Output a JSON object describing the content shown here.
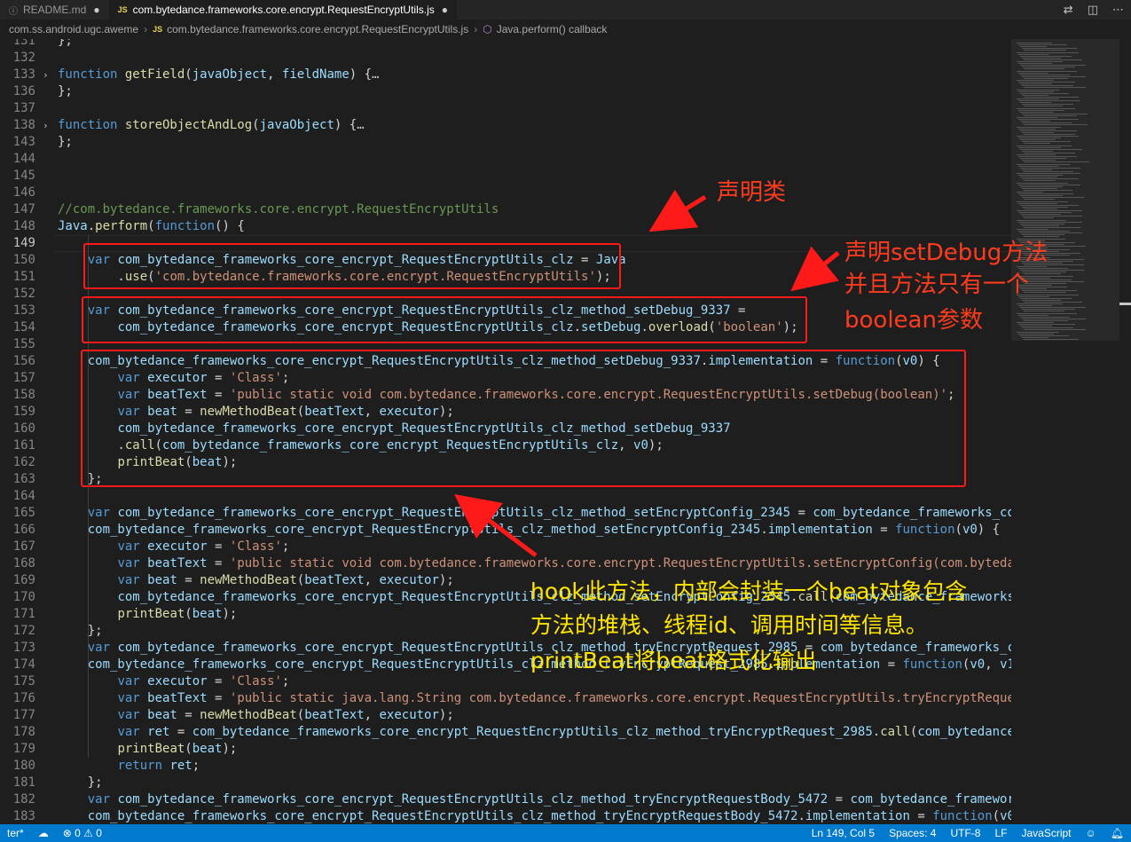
{
  "tabs": [
    {
      "icon": "ⓘ",
      "label": "README.md",
      "dirty": "●"
    },
    {
      "icon": "JS",
      "label": "com.bytedance.frameworks.core.encrypt.RequestEncryptUtils.js",
      "dirty": "●"
    }
  ],
  "breadcrumb": {
    "folder": "com.ss.android.ugc.aweme",
    "file_icon": "JS",
    "file": "com.bytedance.frameworks.core.encrypt.RequestEncryptUtils.js",
    "symbol": "Java.perform() callback"
  },
  "annotations": {
    "declare_class": "声明类",
    "declare_method": [
      "声明setDebug方法",
      "并且方法只有一个",
      "boolean参数"
    ],
    "hook_desc": [
      "hook此方法，内部会封装一个beat对象包含",
      "方法的堆栈、线程id、调用时间等信息。",
      "printBeat将beat格式化输出"
    ]
  },
  "status": {
    "left_mode": "ter*",
    "errors": "0",
    "warnings": "0",
    "position": "Ln 149, Col 5",
    "spaces": "Spaces: 4",
    "encoding": "UTF-8",
    "eol": "LF",
    "language": "JavaScript"
  },
  "code_lines": [
    {
      "n": "131",
      "t": [
        [
          "pl",
          "};"
        ]
      ]
    },
    {
      "n": "132",
      "t": []
    },
    {
      "n": "133",
      "fold": "›",
      "t": [
        [
          "kw",
          "function "
        ],
        [
          "fn",
          "getField"
        ],
        [
          "pl",
          "("
        ],
        [
          "var",
          "javaObject"
        ],
        [
          "pl",
          ", "
        ],
        [
          "var",
          "fieldName"
        ],
        [
          "pl",
          ") {"
        ],
        [
          "ell",
          "…"
        ]
      ]
    },
    {
      "n": "136",
      "t": [
        [
          "pl",
          "};"
        ]
      ]
    },
    {
      "n": "137",
      "t": []
    },
    {
      "n": "138",
      "fold": "›",
      "t": [
        [
          "kw",
          "function "
        ],
        [
          "fn",
          "storeObjectAndLog"
        ],
        [
          "pl",
          "("
        ],
        [
          "var",
          "javaObject"
        ],
        [
          "pl",
          ") {"
        ],
        [
          "ell",
          "…"
        ]
      ]
    },
    {
      "n": "143",
      "t": [
        [
          "pl",
          "};"
        ]
      ]
    },
    {
      "n": "144",
      "t": []
    },
    {
      "n": "145",
      "t": []
    },
    {
      "n": "146",
      "t": []
    },
    {
      "n": "147",
      "t": [
        [
          "cm",
          "//com.bytedance.frameworks.core.encrypt.RequestEncryptUtils"
        ]
      ]
    },
    {
      "n": "148",
      "t": [
        [
          "var",
          "Java"
        ],
        [
          "pl",
          "."
        ],
        [
          "fn",
          "perform"
        ],
        [
          "pl",
          "("
        ],
        [
          "kw",
          "function"
        ],
        [
          "pl",
          "() {"
        ]
      ]
    },
    {
      "n": "149",
      "t": [],
      "current": true
    },
    {
      "n": "150",
      "t": [
        [
          "pl",
          "    "
        ],
        [
          "kw",
          "var "
        ],
        [
          "var",
          "com_bytedance_frameworks_core_encrypt_RequestEncryptUtils_clz"
        ],
        [
          "pl",
          " = "
        ],
        [
          "var",
          "Java"
        ]
      ]
    },
    {
      "n": "151",
      "t": [
        [
          "pl",
          "        ."
        ],
        [
          "fn",
          "use"
        ],
        [
          "pl",
          "("
        ],
        [
          "str",
          "'com.bytedance.frameworks.core.encrypt.RequestEncryptUtils'"
        ],
        [
          "pl",
          ");"
        ]
      ]
    },
    {
      "n": "152",
      "t": []
    },
    {
      "n": "153",
      "t": [
        [
          "pl",
          "    "
        ],
        [
          "kw",
          "var "
        ],
        [
          "var",
          "com_bytedance_frameworks_core_encrypt_RequestEncryptUtils_clz_method_setDebug_9337"
        ],
        [
          "pl",
          " ="
        ]
      ]
    },
    {
      "n": "154",
      "t": [
        [
          "pl",
          "        "
        ],
        [
          "var",
          "com_bytedance_frameworks_core_encrypt_RequestEncryptUtils_clz"
        ],
        [
          "pl",
          "."
        ],
        [
          "var",
          "setDebug"
        ],
        [
          "pl",
          "."
        ],
        [
          "fn",
          "overload"
        ],
        [
          "pl",
          "("
        ],
        [
          "str",
          "'boolean'"
        ],
        [
          "pl",
          ");"
        ]
      ]
    },
    {
      "n": "155",
      "t": []
    },
    {
      "n": "156",
      "t": [
        [
          "pl",
          "    "
        ],
        [
          "var",
          "com_bytedance_frameworks_core_encrypt_RequestEncryptUtils_clz_method_setDebug_9337"
        ],
        [
          "pl",
          "."
        ],
        [
          "var",
          "implementation"
        ],
        [
          "pl",
          " = "
        ],
        [
          "kw",
          "function"
        ],
        [
          "pl",
          "("
        ],
        [
          "var",
          "v0"
        ],
        [
          "pl",
          ") {"
        ]
      ]
    },
    {
      "n": "157",
      "t": [
        [
          "pl",
          "        "
        ],
        [
          "kw",
          "var "
        ],
        [
          "var",
          "executor"
        ],
        [
          "pl",
          " = "
        ],
        [
          "str",
          "'Class'"
        ],
        [
          "pl",
          ";"
        ]
      ]
    },
    {
      "n": "158",
      "t": [
        [
          "pl",
          "        "
        ],
        [
          "kw",
          "var "
        ],
        [
          "var",
          "beatText"
        ],
        [
          "pl",
          " = "
        ],
        [
          "str",
          "'public static void com.bytedance.frameworks.core.encrypt.RequestEncryptUtils.setDebug(boolean)'"
        ],
        [
          "pl",
          ";"
        ]
      ]
    },
    {
      "n": "159",
      "t": [
        [
          "pl",
          "        "
        ],
        [
          "kw",
          "var "
        ],
        [
          "var",
          "beat"
        ],
        [
          "pl",
          " = "
        ],
        [
          "fn",
          "newMethodBeat"
        ],
        [
          "pl",
          "("
        ],
        [
          "var",
          "beatText"
        ],
        [
          "pl",
          ", "
        ],
        [
          "var",
          "executor"
        ],
        [
          "pl",
          ");"
        ]
      ]
    },
    {
      "n": "160",
      "t": [
        [
          "pl",
          "        "
        ],
        [
          "var",
          "com_bytedance_frameworks_core_encrypt_RequestEncryptUtils_clz_method_setDebug_9337"
        ]
      ]
    },
    {
      "n": "161",
      "t": [
        [
          "pl",
          "        ."
        ],
        [
          "fn",
          "call"
        ],
        [
          "pl",
          "("
        ],
        [
          "var",
          "com_bytedance_frameworks_core_encrypt_RequestEncryptUtils_clz"
        ],
        [
          "pl",
          ", "
        ],
        [
          "var",
          "v0"
        ],
        [
          "pl",
          ");"
        ]
      ]
    },
    {
      "n": "162",
      "t": [
        [
          "pl",
          "        "
        ],
        [
          "fn",
          "printBeat"
        ],
        [
          "pl",
          "("
        ],
        [
          "var",
          "beat"
        ],
        [
          "pl",
          ");"
        ]
      ]
    },
    {
      "n": "163",
      "t": [
        [
          "pl",
          "    };"
        ]
      ]
    },
    {
      "n": "164",
      "t": []
    },
    {
      "n": "165",
      "t": [
        [
          "pl",
          "    "
        ],
        [
          "kw",
          "var "
        ],
        [
          "var",
          "com_bytedance_frameworks_core_encrypt_RequestEncryptUtils_clz_method_setEncryptConfig_2345"
        ],
        [
          "pl",
          " = "
        ],
        [
          "var",
          "com_bytedance_frameworks_core_encrypt_RequestEncryptUtils_clz"
        ]
      ]
    },
    {
      "n": "166",
      "t": [
        [
          "pl",
          "    "
        ],
        [
          "var",
          "com_bytedance_frameworks_core_encrypt_RequestEncryptUtils_clz_method_setEncryptConfig_2345"
        ],
        [
          "pl",
          "."
        ],
        [
          "var",
          "implementation"
        ],
        [
          "pl",
          " = "
        ],
        [
          "kw",
          "function"
        ],
        [
          "pl",
          "("
        ],
        [
          "var",
          "v0"
        ],
        [
          "pl",
          ") {"
        ]
      ]
    },
    {
      "n": "167",
      "t": [
        [
          "pl",
          "        "
        ],
        [
          "kw",
          "var "
        ],
        [
          "var",
          "executor"
        ],
        [
          "pl",
          " = "
        ],
        [
          "str",
          "'Class'"
        ],
        [
          "pl",
          ";"
        ]
      ]
    },
    {
      "n": "168",
      "t": [
        [
          "pl",
          "        "
        ],
        [
          "kw",
          "var "
        ],
        [
          "var",
          "beatText"
        ],
        [
          "pl",
          " = "
        ],
        [
          "str",
          "'public static void com.bytedance.frameworks.core.encrypt.RequestEncryptUtils.setEncryptConfig(com.bytedance.frameworks"
        ]
      ]
    },
    {
      "n": "169",
      "t": [
        [
          "pl",
          "        "
        ],
        [
          "kw",
          "var "
        ],
        [
          "var",
          "beat"
        ],
        [
          "pl",
          " = "
        ],
        [
          "fn",
          "newMethodBeat"
        ],
        [
          "pl",
          "("
        ],
        [
          "var",
          "beatText"
        ],
        [
          "pl",
          ", "
        ],
        [
          "var",
          "executor"
        ],
        [
          "pl",
          ");"
        ]
      ]
    },
    {
      "n": "170",
      "t": [
        [
          "pl",
          "        "
        ],
        [
          "var",
          "com_bytedance_frameworks_core_encrypt_RequestEncryptUtils_clz_method_setEncryptConfig_2345"
        ],
        [
          "pl",
          "."
        ],
        [
          "fn",
          "call"
        ],
        [
          "pl",
          "("
        ],
        [
          "var",
          "com_bytedance_frameworks"
        ]
      ]
    },
    {
      "n": "171",
      "t": [
        [
          "pl",
          "        "
        ],
        [
          "fn",
          "printBeat"
        ],
        [
          "pl",
          "("
        ],
        [
          "var",
          "beat"
        ],
        [
          "pl",
          ");"
        ]
      ]
    },
    {
      "n": "172",
      "t": [
        [
          "pl",
          "    };"
        ]
      ]
    },
    {
      "n": "173",
      "t": [
        [
          "pl",
          "    "
        ],
        [
          "kw",
          "var "
        ],
        [
          "var",
          "com_bytedance_frameworks_core_encrypt_RequestEncryptUtils_clz_method_tryEncryptRequest_2985"
        ],
        [
          "pl",
          " = "
        ],
        [
          "var",
          "com_bytedance_frameworks_core"
        ]
      ]
    },
    {
      "n": "174",
      "t": [
        [
          "pl",
          "    "
        ],
        [
          "var",
          "com_bytedance_frameworks_core_encrypt_RequestEncryptUtils_clz_method_tryEncryptRequest_2985"
        ],
        [
          "pl",
          "."
        ],
        [
          "var",
          "implementation"
        ],
        [
          "pl",
          " = "
        ],
        [
          "kw",
          "function"
        ],
        [
          "pl",
          "("
        ],
        [
          "var",
          "v0"
        ],
        [
          "pl",
          ", "
        ],
        [
          "var",
          "v1"
        ],
        [
          "pl",
          ") {"
        ]
      ]
    },
    {
      "n": "175",
      "t": [
        [
          "pl",
          "        "
        ],
        [
          "kw",
          "var "
        ],
        [
          "var",
          "executor"
        ],
        [
          "pl",
          " = "
        ],
        [
          "str",
          "'Class'"
        ],
        [
          "pl",
          ";"
        ]
      ]
    },
    {
      "n": "176",
      "t": [
        [
          "pl",
          "        "
        ],
        [
          "kw",
          "var "
        ],
        [
          "var",
          "beatText"
        ],
        [
          "pl",
          " = "
        ],
        [
          "str",
          "'public static java.lang.String com.bytedance.frameworks.core.encrypt.RequestEncryptUtils.tryEncryptRequest(java.lang"
        ]
      ]
    },
    {
      "n": "177",
      "t": [
        [
          "pl",
          "        "
        ],
        [
          "kw",
          "var "
        ],
        [
          "var",
          "beat"
        ],
        [
          "pl",
          " = "
        ],
        [
          "fn",
          "newMethodBeat"
        ],
        [
          "pl",
          "("
        ],
        [
          "var",
          "beatText"
        ],
        [
          "pl",
          ", "
        ],
        [
          "var",
          "executor"
        ],
        [
          "pl",
          ");"
        ]
      ]
    },
    {
      "n": "178",
      "t": [
        [
          "pl",
          "        "
        ],
        [
          "kw",
          "var "
        ],
        [
          "var",
          "ret"
        ],
        [
          "pl",
          " = "
        ],
        [
          "var",
          "com_bytedance_frameworks_core_encrypt_RequestEncryptUtils_clz_method_tryEncryptRequest_2985"
        ],
        [
          "pl",
          "."
        ],
        [
          "fn",
          "call"
        ],
        [
          "pl",
          "("
        ],
        [
          "var",
          "com_bytedance_frameworks"
        ]
      ]
    },
    {
      "n": "179",
      "t": [
        [
          "pl",
          "        "
        ],
        [
          "fn",
          "printBeat"
        ],
        [
          "pl",
          "("
        ],
        [
          "var",
          "beat"
        ],
        [
          "pl",
          ");"
        ]
      ]
    },
    {
      "n": "180",
      "t": [
        [
          "pl",
          "        "
        ],
        [
          "kw",
          "return "
        ],
        [
          "var",
          "ret"
        ],
        [
          "pl",
          ";"
        ]
      ]
    },
    {
      "n": "181",
      "t": [
        [
          "pl",
          "    };"
        ]
      ]
    },
    {
      "n": "182",
      "t": [
        [
          "pl",
          "    "
        ],
        [
          "kw",
          "var "
        ],
        [
          "var",
          "com_bytedance_frameworks_core_encrypt_RequestEncryptUtils_clz_method_tryEncryptRequestBody_5472"
        ],
        [
          "pl",
          " = "
        ],
        [
          "var",
          "com_bytedance_frameworks_core"
        ]
      ]
    },
    {
      "n": "183",
      "t": [
        [
          "pl",
          "    "
        ],
        [
          "var",
          "com_bytedance_frameworks_core_encrypt_RequestEncryptUtils_clz_method_tryEncryptRequestBody_5472"
        ],
        [
          "pl",
          "."
        ],
        [
          "var",
          "implementation"
        ],
        [
          "pl",
          " = "
        ],
        [
          "kw",
          "function"
        ],
        [
          "pl",
          "("
        ],
        [
          "var",
          "v0"
        ],
        [
          "pl",
          ") {"
        ]
      ]
    }
  ]
}
